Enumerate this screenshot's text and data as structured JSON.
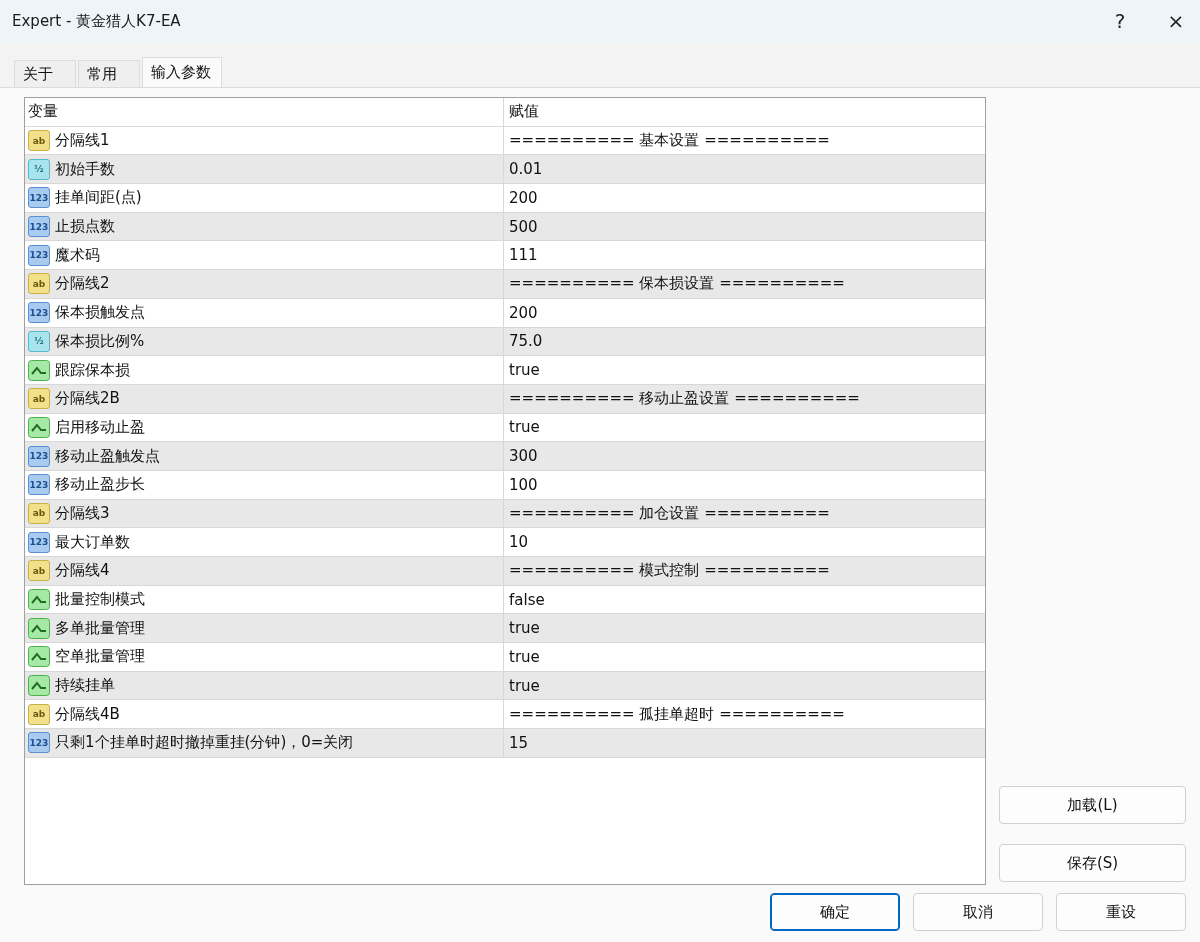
{
  "window": {
    "title": "Expert - 黄金猎人K7-EA",
    "help": "?",
    "close": "×"
  },
  "tabs": [
    {
      "label": "关于",
      "selected": false
    },
    {
      "label": "常用",
      "selected": false
    },
    {
      "label": "输入参数",
      "selected": true
    }
  ],
  "table": {
    "columns": [
      "变量",
      "赋值"
    ],
    "rows": [
      {
        "kind": "string",
        "icon": "ab",
        "name": "分隔线1",
        "value": "========== 基本设置 =========="
      },
      {
        "kind": "double",
        "icon": "½",
        "name": "初始手数",
        "value": "0.01"
      },
      {
        "kind": "int",
        "icon": "123",
        "name": "挂单间距(点)",
        "value": "200"
      },
      {
        "kind": "int",
        "icon": "123",
        "name": "止损点数",
        "value": "500"
      },
      {
        "kind": "int",
        "icon": "123",
        "name": "魔术码",
        "value": "111"
      },
      {
        "kind": "string",
        "icon": "ab",
        "name": "分隔线2",
        "value": "========== 保本损设置 =========="
      },
      {
        "kind": "int",
        "icon": "123",
        "name": "保本损触发点",
        "value": "200"
      },
      {
        "kind": "double",
        "icon": "½",
        "name": "保本损比例%",
        "value": "75.0"
      },
      {
        "kind": "bool",
        "name": "跟踪保本损",
        "value": "true"
      },
      {
        "kind": "string",
        "icon": "ab",
        "name": "分隔线2B",
        "value": "========== 移动止盈设置 =========="
      },
      {
        "kind": "bool",
        "name": "启用移动止盈",
        "value": "true"
      },
      {
        "kind": "int",
        "icon": "123",
        "name": "移动止盈触发点",
        "value": "300"
      },
      {
        "kind": "int",
        "icon": "123",
        "name": "移动止盈步长",
        "value": "100"
      },
      {
        "kind": "string",
        "icon": "ab",
        "name": "分隔线3",
        "value": "========== 加仓设置 =========="
      },
      {
        "kind": "int",
        "icon": "123",
        "name": "最大订单数",
        "value": "10"
      },
      {
        "kind": "string",
        "icon": "ab",
        "name": "分隔线4",
        "value": "========== 模式控制 =========="
      },
      {
        "kind": "bool",
        "name": "批量控制模式",
        "value": "false"
      },
      {
        "kind": "bool",
        "name": "多单批量管理",
        "value": "true"
      },
      {
        "kind": "bool",
        "name": "空单批量管理",
        "value": "true"
      },
      {
        "kind": "bool",
        "name": "持续挂单",
        "value": "true"
      },
      {
        "kind": "string",
        "icon": "ab",
        "name": "分隔线4B",
        "value": "========== 孤挂单超时 =========="
      },
      {
        "kind": "int",
        "icon": "123",
        "name": "只剩1个挂单时超时撤掉重挂(分钟)，0=关闭",
        "value": "15"
      }
    ]
  },
  "side_buttons": [
    "加载(L)",
    "保存(S)"
  ],
  "buttons": [
    {
      "label": "确定",
      "default": true
    },
    {
      "label": "取消",
      "default": false
    },
    {
      "label": "重设",
      "default": false
    }
  ]
}
